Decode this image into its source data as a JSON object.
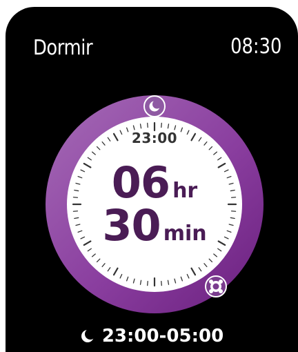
{
  "app": {
    "title": "Dormir",
    "clock": "08:30"
  },
  "dial": {
    "start_time": "23:00",
    "duration_hours": "06",
    "hours_unit": "hr",
    "duration_minutes": "30",
    "minutes_unit": "min",
    "start_handle_icon": "moon-icon",
    "end_handle_icon": "alarm-icon",
    "colors": {
      "ring_dark": "#6a1f7e",
      "ring_light": "#a569b5",
      "face": "#ffffff",
      "text": "#4a1c55"
    }
  },
  "footer": {
    "range_icon": "moon-icon",
    "range": "23:00-05:00"
  }
}
